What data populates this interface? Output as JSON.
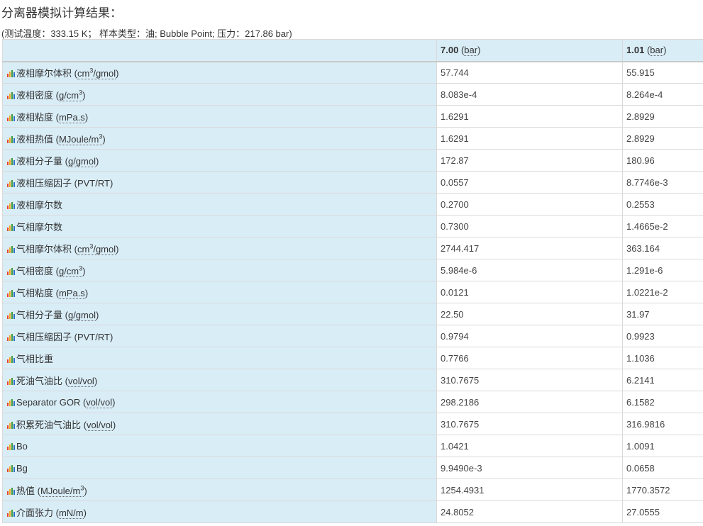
{
  "title": "分离器模拟计算结果：",
  "subtitle": {
    "prefix": "(测试温度：333.15 ",
    "temp_unit": "K",
    "mid": "；  样本类型：油; Bubble Point; 压力：217.86 ",
    "pressure_unit": "bar",
    "suffix": ")"
  },
  "columns": [
    {
      "value": "7.00",
      "unit": "bar"
    },
    {
      "value": "1.01",
      "unit": "bar"
    }
  ],
  "icon": "bar-chart-icon",
  "rows": [
    {
      "label": "液相摩尔体积",
      "unit_pre": "cm",
      "unit_sup": "3",
      "unit_post": "/gmol",
      "v1": "57.744",
      "v2": "55.915"
    },
    {
      "label": "液相密度",
      "unit_pre": "g/cm",
      "unit_sup": "3",
      "unit_post": "",
      "v1": "8.083e-4",
      "v2": "8.264e-4"
    },
    {
      "label": "液相粘度",
      "unit_pre": "mPa.s",
      "unit_sup": "",
      "unit_post": "",
      "v1": "1.6291",
      "v2": "2.8929"
    },
    {
      "label": "液相热值",
      "unit_pre": "MJoule/m",
      "unit_sup": "3",
      "unit_post": "",
      "v1": "1.6291",
      "v2": "2.8929"
    },
    {
      "label": "液相分子量",
      "unit_pre": "g/gmol",
      "unit_sup": "",
      "unit_post": "",
      "v1": "172.87",
      "v2": "180.96"
    },
    {
      "label": "液相压缩因子",
      "unit_pre": "PVT/RT",
      "unit_sup": "",
      "unit_post": "",
      "plain": true,
      "v1": "0.0557",
      "v2": "8.7746e-3"
    },
    {
      "label": "液相摩尔数",
      "unit_pre": "",
      "unit_sup": "",
      "unit_post": "",
      "v1": "0.2700",
      "v2": "0.2553"
    },
    {
      "label": "气相摩尔数",
      "unit_pre": "",
      "unit_sup": "",
      "unit_post": "",
      "v1": "0.7300",
      "v2": "1.4665e-2"
    },
    {
      "label": "气相摩尔体积",
      "unit_pre": "cm",
      "unit_sup": "3",
      "unit_post": "/gmol",
      "v1": "2744.417",
      "v2": "363.164"
    },
    {
      "label": "气相密度",
      "unit_pre": "g/cm",
      "unit_sup": "3",
      "unit_post": "",
      "v1": "5.984e-6",
      "v2": "1.291e-6"
    },
    {
      "label": "气相粘度",
      "unit_pre": "mPa.s",
      "unit_sup": "",
      "unit_post": "",
      "v1": "0.0121",
      "v2": "1.0221e-2"
    },
    {
      "label": "气相分子量",
      "unit_pre": "g/gmol",
      "unit_sup": "",
      "unit_post": "",
      "v1": "22.50",
      "v2": "31.97"
    },
    {
      "label": "气相压缩因子",
      "unit_pre": "PVT/RT",
      "unit_sup": "",
      "unit_post": "",
      "plain": true,
      "v1": "0.9794",
      "v2": "0.9923"
    },
    {
      "label": "气相比重",
      "unit_pre": "",
      "unit_sup": "",
      "unit_post": "",
      "v1": "0.7766",
      "v2": "1.1036"
    },
    {
      "label": "死油气油比",
      "unit_pre": "vol/vol",
      "unit_sup": "",
      "unit_post": "",
      "v1": "310.7675",
      "v2": "6.2141"
    },
    {
      "label": "Separator GOR",
      "unit_pre": "vol/vol",
      "unit_sup": "",
      "unit_post": "",
      "v1": "298.2186",
      "v2": "6.1582"
    },
    {
      "label": "积累死油气油比",
      "unit_pre": "vol/vol",
      "unit_sup": "",
      "unit_post": "",
      "v1": "310.7675",
      "v2": "316.9816"
    },
    {
      "label": "Bo",
      "unit_pre": "",
      "unit_sup": "",
      "unit_post": "",
      "v1": "1.0421",
      "v2": "1.0091"
    },
    {
      "label": "Bg",
      "unit_pre": "",
      "unit_sup": "",
      "unit_post": "",
      "v1": "9.9490e-3",
      "v2": "0.0658"
    },
    {
      "label": "热值",
      "unit_pre": "MJoule/m",
      "unit_sup": "3",
      "unit_post": "",
      "v1": "1254.4931",
      "v2": "1770.3572"
    },
    {
      "label": "介面张力",
      "unit_pre": "mN/m",
      "unit_sup": "",
      "unit_post": "",
      "v1": "24.8052",
      "v2": "27.0555"
    }
  ]
}
